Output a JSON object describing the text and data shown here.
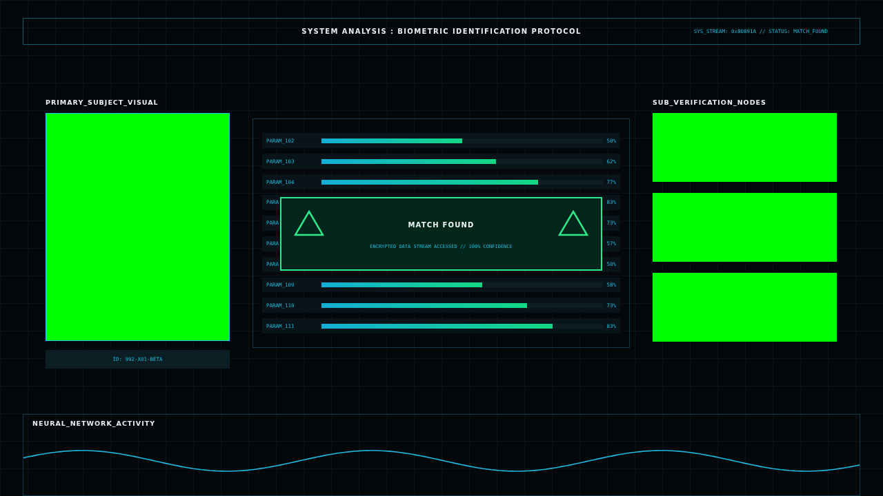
{
  "header": {
    "title": "SYSTEM ANALYSIS : BIOMETRIC IDENTIFICATION PROTOCOL",
    "status": "SYS_STREAM: 0x80891A // STATUS: MATCH_FOUND"
  },
  "primary": {
    "title": "PRIMARY_SUBJECT_VISUAL",
    "id_label": "ID: 992-X01-BETA"
  },
  "params": [
    {
      "label": "PARAM_102",
      "level": 0.5,
      "value": "50%"
    },
    {
      "label": "PARAM_103",
      "level": 0.62,
      "value": "62%"
    },
    {
      "label": "PARAM_104",
      "level": 0.77,
      "value": "77%"
    },
    {
      "label": "PARA",
      "value": "83%"
    },
    {
      "label": "PARA",
      "value": "73%"
    },
    {
      "label": "PARA",
      "value": "57%"
    },
    {
      "label": "PARA",
      "value": "50%"
    },
    {
      "label": "PARAM_109",
      "level": 0.57,
      "value": "58%"
    },
    {
      "label": "PARAM_110",
      "level": 0.73,
      "value": "73%"
    },
    {
      "label": "PARAM_111",
      "level": 0.82,
      "value": "83%"
    }
  ],
  "match": {
    "title": "MATCH FOUND",
    "subtitle": "ENCRYPTED DATA STREAM ACCESSED // 100% CONFIDENCE"
  },
  "nodes": {
    "title": "SUB_VERIFICATION_NODES"
  },
  "activity": {
    "title": "NEURAL_NETWORK_ACTIVITY"
  }
}
